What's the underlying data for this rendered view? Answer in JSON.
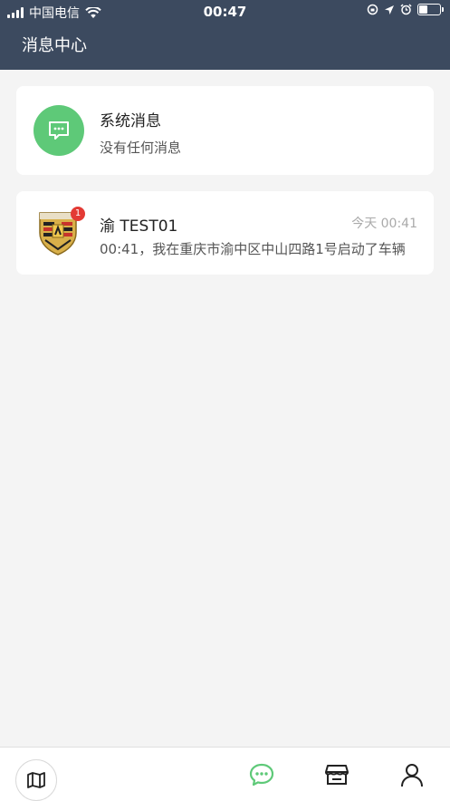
{
  "status_bar": {
    "carrier": "中国电信",
    "time": "00:47"
  },
  "header": {
    "title": "消息中心"
  },
  "messages": [
    {
      "title": "系统消息",
      "subtitle": "没有任何消息",
      "icon": "chat-bubble-icon",
      "color": "#5ec978"
    },
    {
      "title": "渝 TEST01",
      "time": "今天 00:41",
      "subtitle": "00:41，我在重庆市渝中区中山四路1号启动了车辆",
      "badge": "1",
      "icon": "porsche-crest-icon"
    }
  ],
  "tabbar": {
    "items": [
      {
        "icon": "map-icon"
      },
      {
        "icon": "message-icon",
        "active": true,
        "color": "#5ec978"
      },
      {
        "icon": "store-icon"
      },
      {
        "icon": "user-icon"
      }
    ]
  },
  "colors": {
    "header_bg": "#3c4a5f",
    "accent": "#5ec978",
    "badge": "#e33a34"
  }
}
